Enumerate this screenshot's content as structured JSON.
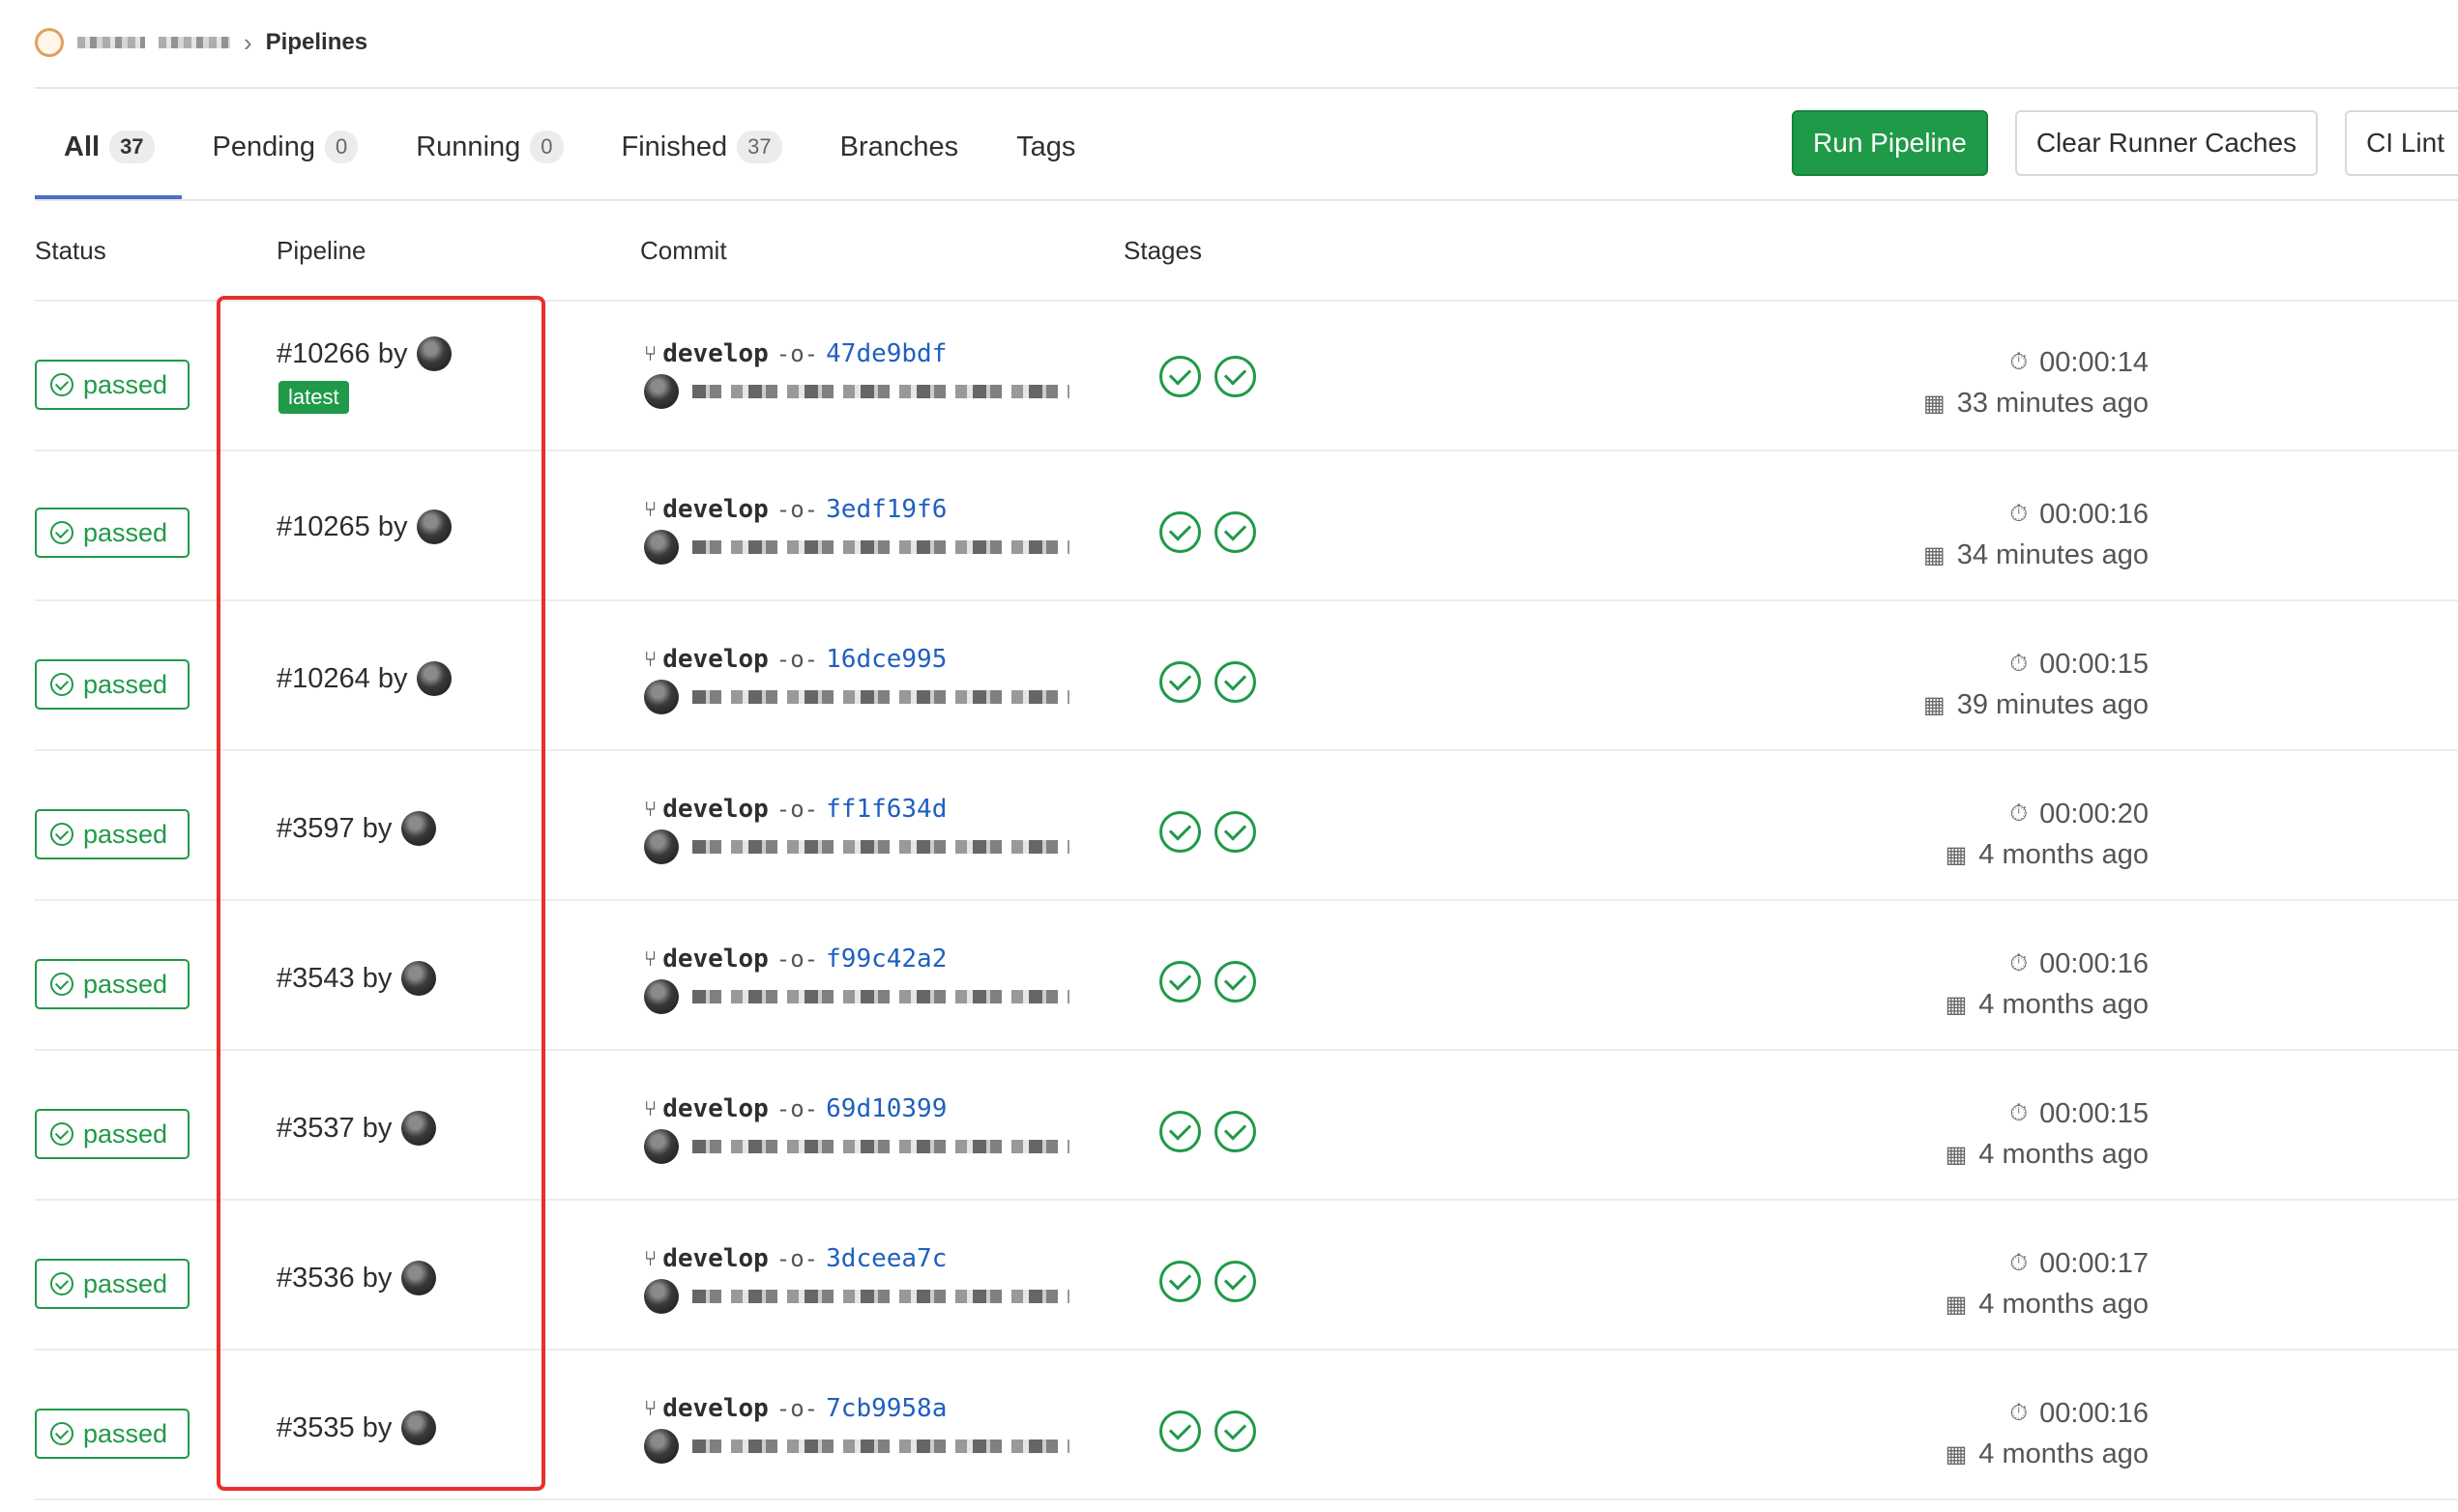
{
  "breadcrumb": {
    "current": "Pipelines",
    "separator": "›"
  },
  "tabs": [
    {
      "label": "All",
      "count": "37"
    },
    {
      "label": "Pending",
      "count": "0"
    },
    {
      "label": "Running",
      "count": "0"
    },
    {
      "label": "Finished",
      "count": "37"
    },
    {
      "label": "Branches"
    },
    {
      "label": "Tags"
    }
  ],
  "actions": {
    "run": "Run Pipeline",
    "clear": "Clear Runner Caches",
    "lint": "CI Lint"
  },
  "columns": {
    "status": "Status",
    "pipeline": "Pipeline",
    "commit": "Commit",
    "stages": "Stages"
  },
  "rows": [
    {
      "status": "passed",
      "pipeline": "#10266 by",
      "badge": "latest",
      "branch": "develop",
      "sha": "47de9bdf",
      "duration": "00:00:14",
      "finished": "33 minutes ago"
    },
    {
      "status": "passed",
      "pipeline": "#10265 by",
      "branch": "develop",
      "sha": "3edf19f6",
      "duration": "00:00:16",
      "finished": "34 minutes ago"
    },
    {
      "status": "passed",
      "pipeline": "#10264 by",
      "branch": "develop",
      "sha": "16dce995",
      "duration": "00:00:15",
      "finished": "39 minutes ago"
    },
    {
      "status": "passed",
      "pipeline": "#3597 by",
      "branch": "develop",
      "sha": "ff1f634d",
      "duration": "00:00:20",
      "finished": "4 months ago"
    },
    {
      "status": "passed",
      "pipeline": "#3543 by",
      "branch": "develop",
      "sha": "f99c42a2",
      "duration": "00:00:16",
      "finished": "4 months ago"
    },
    {
      "status": "passed",
      "pipeline": "#3537 by",
      "branch": "develop",
      "sha": "69d10399",
      "duration": "00:00:15",
      "finished": "4 months ago"
    },
    {
      "status": "passed",
      "pipeline": "#3536 by",
      "branch": "develop",
      "sha": "3dceea7c",
      "duration": "00:00:17",
      "finished": "4 months ago"
    },
    {
      "status": "passed",
      "pipeline": "#3535 by",
      "branch": "develop",
      "sha": "7cb9958a",
      "duration": "00:00:16",
      "finished": "4 months ago"
    }
  ],
  "icons": {
    "status": "check-circle-icon",
    "branch": "branch-icon",
    "commit": "commit-icon",
    "stage": "stage-passed-icon",
    "duration": "timer-icon",
    "finished": "calendar-icon"
  },
  "colors": {
    "success": "#1f9a48",
    "link": "#1f5fbf",
    "highlight": "#e8302b",
    "active_tab": "#4a6fc8"
  }
}
